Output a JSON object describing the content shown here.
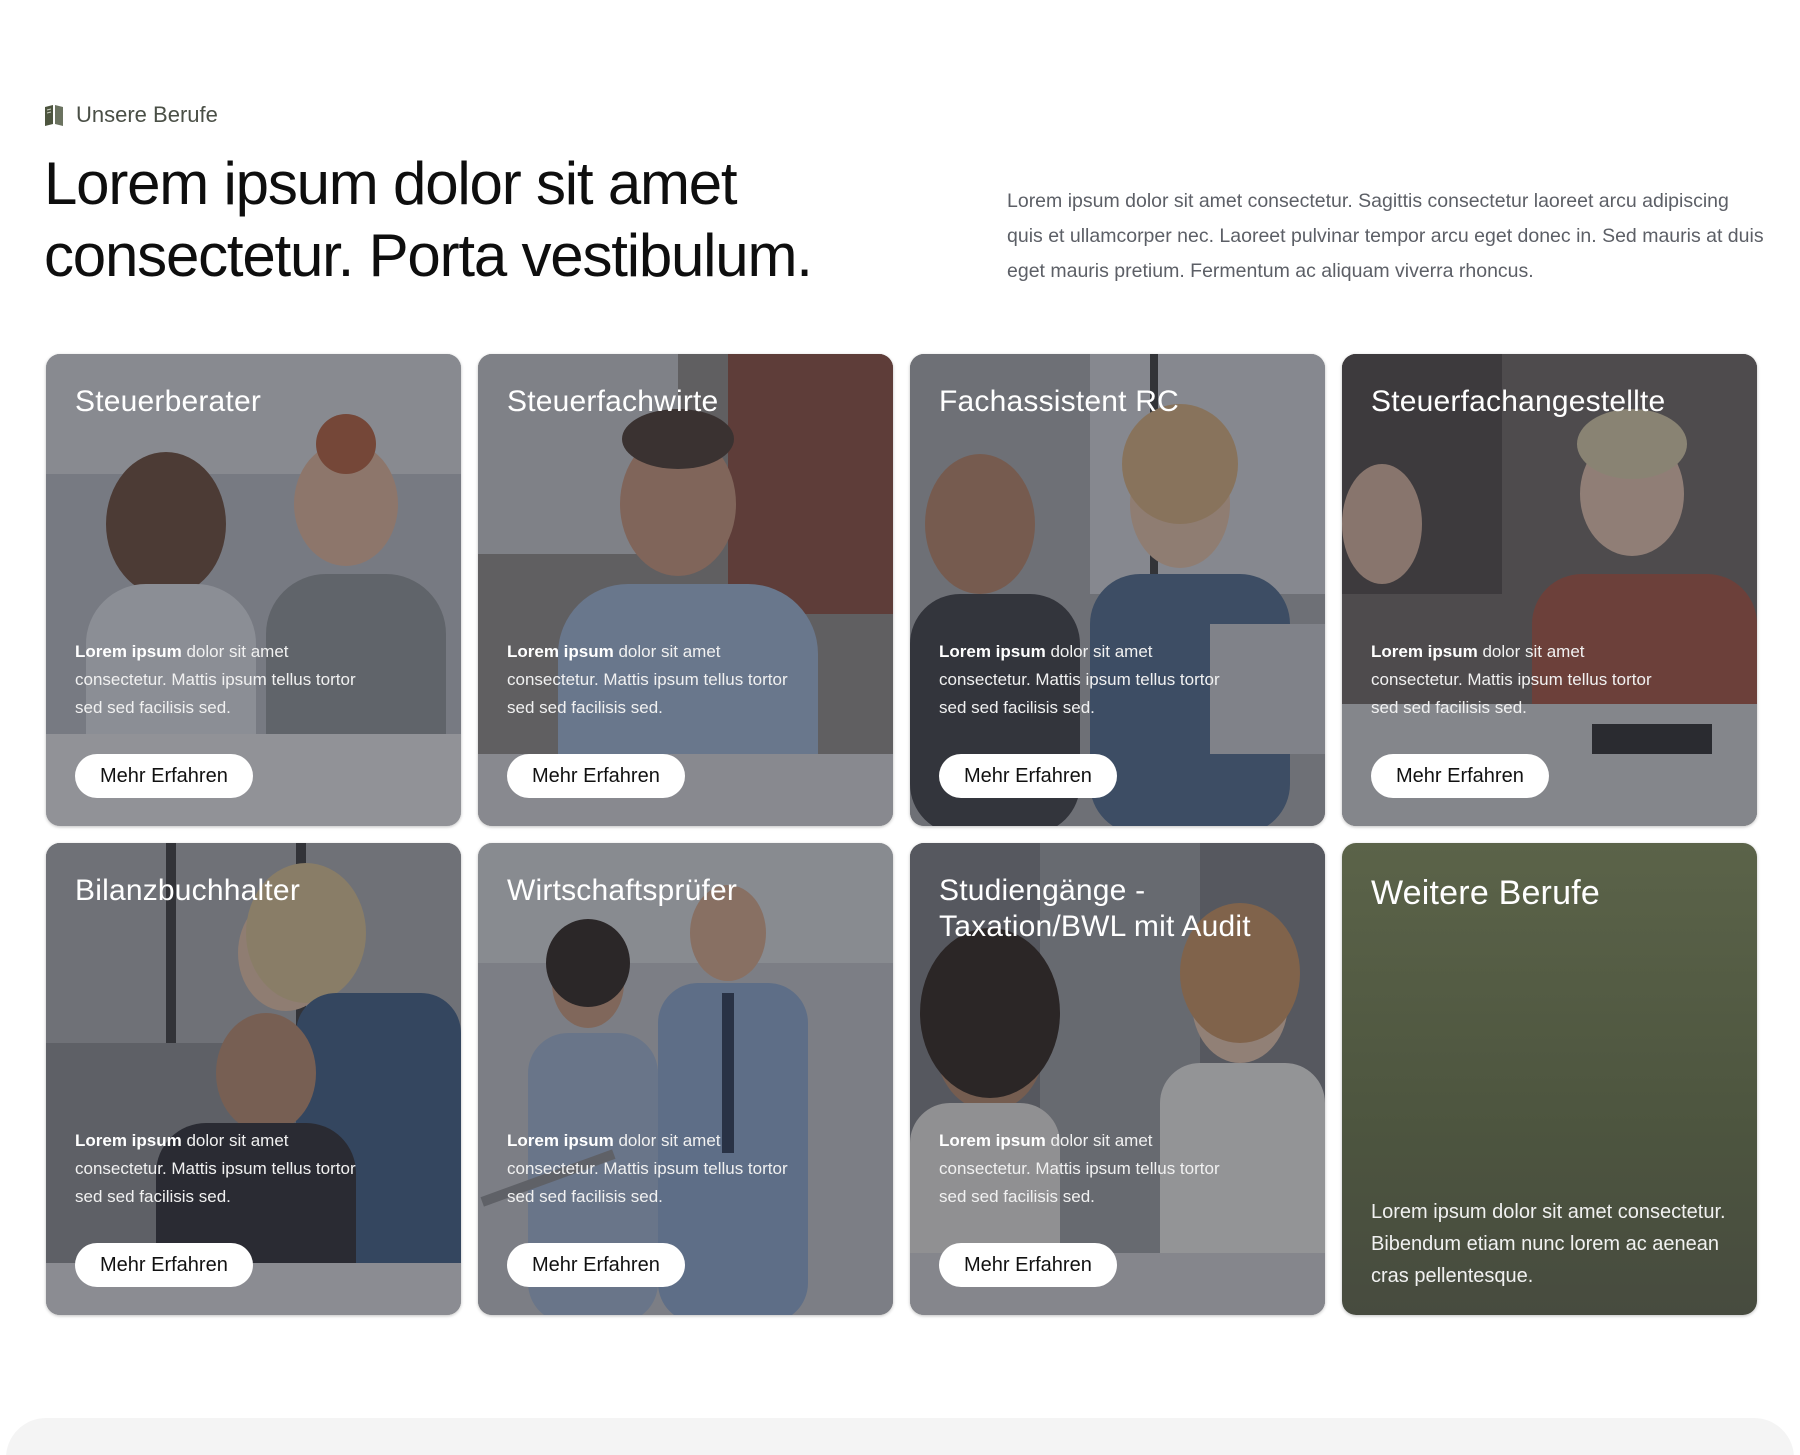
{
  "section": {
    "eyebrow": "Unsere Berufe",
    "eyebrow_icon": "book-icon",
    "headline": "Lorem ipsum dolor sit amet consectetur. Porta vestibulum.",
    "intro": "Lorem ipsum dolor sit amet consectetur. Sagittis consectetur laoreet arcu adipiscing quis et ullamcorper nec. Laoreet pulvinar tempor arcu eget donec in. Sed mauris at duis eget mauris pretium. Fermentum ac aliquam viverra rhoncus."
  },
  "colors": {
    "accent_olive": "#4d553f",
    "text_dark": "#0e0e0e",
    "text_muted": "#5c5f66",
    "button_bg": "#ffffff"
  },
  "cards": [
    {
      "title": "Steuerberater",
      "desc_bold": "Lorem ipsum",
      "desc_rest": " dolor sit amet consectetur. Mattis ipsum tellus tortor sed sed facilisis sed.",
      "button": "Mehr Erfahren"
    },
    {
      "title": "Steuerfachwirte",
      "desc_bold": "Lorem ipsum",
      "desc_rest": " dolor sit amet consectetur. Mattis ipsum tellus tortor sed sed facilisis sed.",
      "button": "Mehr Erfahren"
    },
    {
      "title": "Fachassistent RC",
      "desc_bold": "Lorem ipsum",
      "desc_rest": " dolor sit amet consectetur. Mattis ipsum tellus tortor sed sed facilisis sed.",
      "button": "Mehr Erfahren"
    },
    {
      "title": "Steuerfachangestellte",
      "desc_bold": "Lorem ipsum",
      "desc_rest": " dolor sit amet consectetur. Mattis ipsum tellus tortor sed sed facilisis sed.",
      "button": "Mehr Erfahren"
    },
    {
      "title": "Bilanzbuchhalter",
      "desc_bold": "Lorem ipsum",
      "desc_rest": " dolor sit amet consectetur. Mattis ipsum tellus tortor sed sed facilisis sed.",
      "button": "Mehr Erfahren"
    },
    {
      "title": "Wirtschaftsprüfer",
      "desc_bold": "Lorem ipsum",
      "desc_rest": " dolor sit amet consectetur. Mattis ipsum tellus tortor sed sed facilisis sed.",
      "button": "Mehr Erfahren"
    },
    {
      "title": "Studiengänge - Taxation/BWL mit Audit",
      "desc_bold": "Lorem ipsum",
      "desc_rest": " dolor sit amet consectetur. Mattis ipsum tellus tortor sed sed facilisis sed.",
      "button": "Mehr Erfahren"
    }
  ],
  "more_card": {
    "title": "Weitere Berufe",
    "desc": "Lorem ipsum dolor sit amet consectetur. Bibendum etiam nunc lorem ac aenean cras pellentesque."
  }
}
